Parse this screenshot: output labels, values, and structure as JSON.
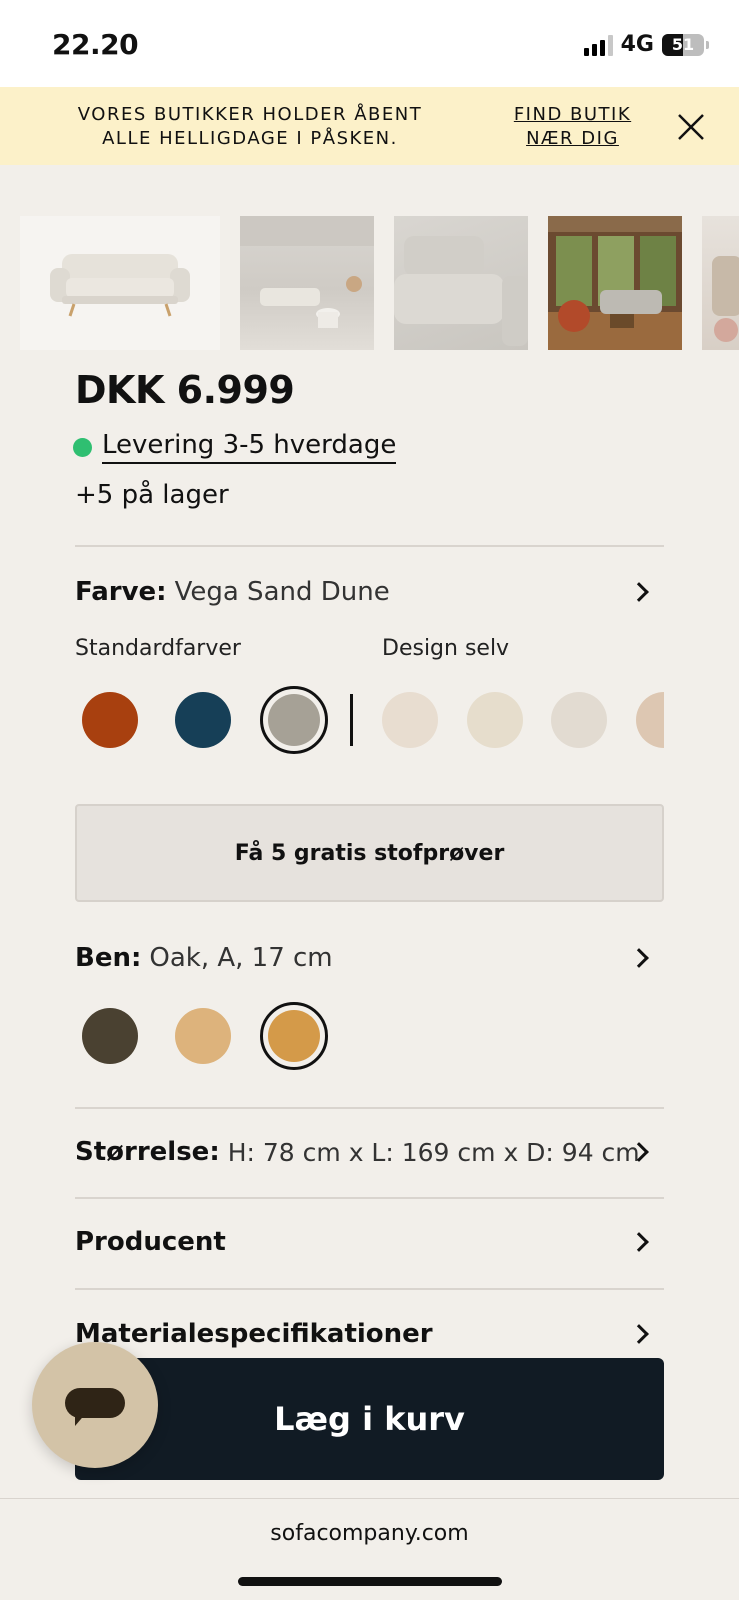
{
  "status_bar": {
    "time": "22.20",
    "network": "4G",
    "battery": "51",
    "battery_level_pct": 51
  },
  "banner": {
    "message": "VORES BUTIKKER HOLDER ÅBENT ALLE HELLIGDAGE I PÅSKEN.",
    "link_label": "FIND BUTIK NÆR DIG",
    "close_icon": "close-icon"
  },
  "gallery": {
    "images": [
      "sofa-studio-shot",
      "sofa-living-room",
      "sofa-seat-closeup",
      "sofa-room-with-windows",
      "sofa-partial-view"
    ]
  },
  "product": {
    "price": "DKK 6.999",
    "delivery": "Levering 3-5 hverdage",
    "delivery_status_color": "#2fbf71",
    "stock": "+5 på lager"
  },
  "color": {
    "label": "Farve:",
    "value": "Vega Sand Dune",
    "standard_heading": "Standardfarver",
    "custom_heading": "Design selv",
    "standard_swatches": [
      "#a8400f",
      "#163f57",
      "#a6a196"
    ],
    "selected_standard_index": 2,
    "custom_swatches": [
      "#e8ddd0",
      "#e6ddcc",
      "#e2dbd1",
      "#ddc7b2"
    ]
  },
  "samples_button": "Få 5 gratis stofprøver",
  "legs": {
    "label": "Ben:",
    "value": "Oak, A, 17 cm",
    "swatches": [
      "#4a4131",
      "#ddb37c",
      "#d49a49"
    ],
    "selected_index": 2
  },
  "size": {
    "label": "Størrelse:",
    "value": "H: 78 cm x L: 169 cm x D: 94 cm"
  },
  "manufacturer": {
    "label": "Producent"
  },
  "materials": {
    "label": "Materialespecifikationer"
  },
  "cart_button": "Læg i kurv",
  "chat": {
    "icon": "chat-bubble-icon"
  },
  "browser": {
    "url": "sofacompany.com"
  }
}
